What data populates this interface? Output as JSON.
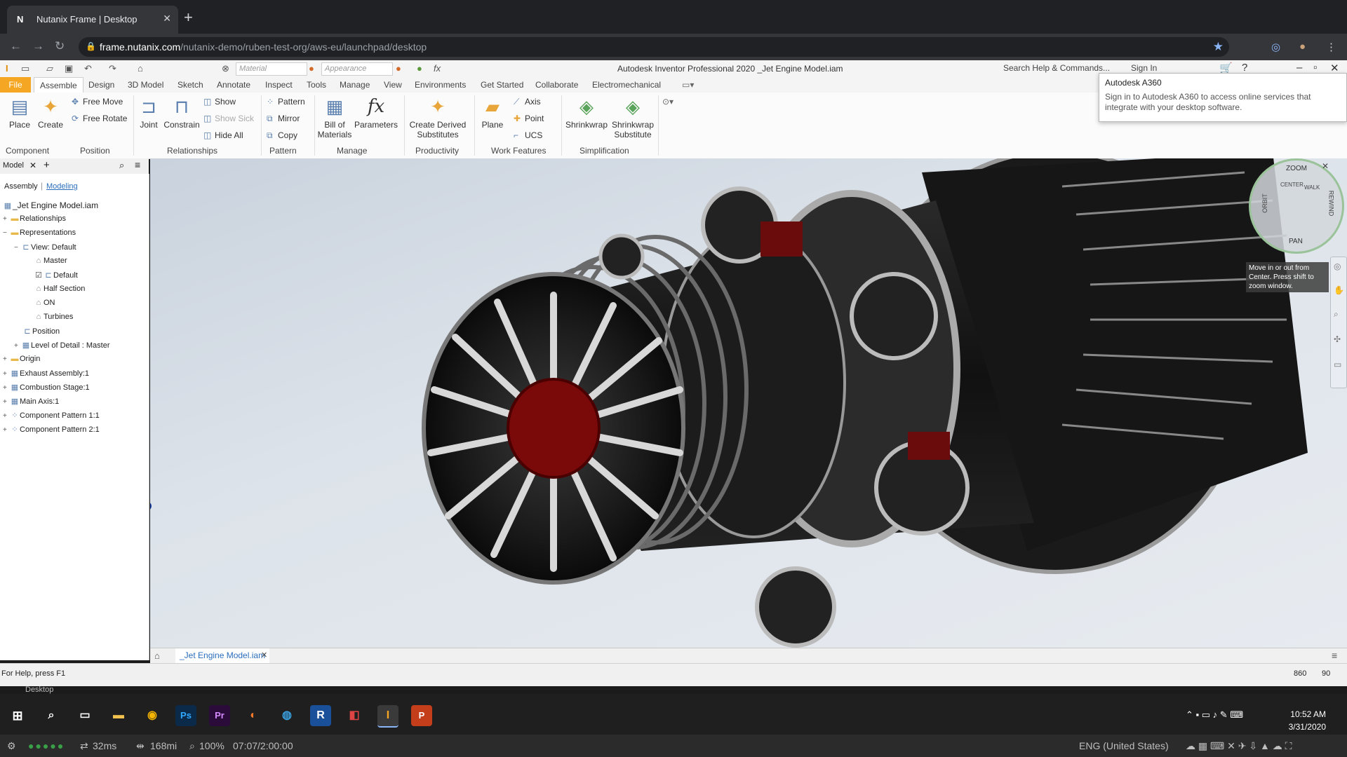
{
  "browser": {
    "tab_title": "Nutanix Frame | Desktop",
    "url_host": "frame.nutanix.com",
    "url_path": "/nutanix-demo/ruben-test-org/aws-eu/launchpad/desktop"
  },
  "inventor": {
    "material_placeholder": "Material",
    "appearance_placeholder": "Appearance",
    "title": "Autodesk Inventor Professional 2020    _Jet Engine Model.iam",
    "search": "Search Help & Commands...",
    "sign_in": "Sign In",
    "tabs": [
      "File",
      "Assemble",
      "Design",
      "3D Model",
      "Sketch",
      "Annotate",
      "Inspect",
      "Tools",
      "Manage",
      "View",
      "Environments",
      "Get Started",
      "Collaborate",
      "Electromechanical"
    ],
    "ribbon": {
      "place": "Place",
      "create": "Create",
      "free_move": "Free Move",
      "free_rotate": "Free Rotate",
      "joint": "Joint",
      "constrain": "Constrain",
      "show": "Show",
      "show_sick": "Show Sick",
      "hide_all": "Hide All",
      "pattern": "Pattern",
      "mirror": "Mirror",
      "copy": "Copy",
      "bom": "Bill of\nMaterials",
      "bom1": "Bill of",
      "bom2": "Materials",
      "parameters": "Parameters",
      "cds1": "Create Derived",
      "cds2": "Substitutes",
      "plane": "Plane",
      "axis": "Axis",
      "point": "Point",
      "ucs": "UCS",
      "shrinkwrap": "Shrinkwrap",
      "sws1": "Shrinkwrap",
      "sws2": "Substitute",
      "groups": [
        "Component",
        "Position",
        "Relationships",
        "Pattern",
        "Manage",
        "Productivity",
        "Work Features",
        "Simplification"
      ]
    },
    "tooltip": {
      "title": "Autodesk A360",
      "body": "Sign in to Autodesk A360 to access online services that integrate with your desktop software."
    },
    "pane": {
      "tab": "Model",
      "subtab_assembly": "Assembly",
      "subtab_modeling": "Modeling",
      "tree": [
        "_Jet Engine Model.iam",
        "Relationships",
        "Representations",
        "View: Default",
        "Master",
        "Default",
        "Half Section",
        "ON",
        "Turbines",
        "Position",
        "Level of Detail : Master",
        "Origin",
        "Exhaust Assembly:1",
        "Combustion Stage:1",
        "Main Axis:1",
        "Component Pattern 1:1",
        "Component Pattern 2:1"
      ]
    },
    "viewcube": {
      "zoom": "ZOOM",
      "orbit": "ORBIT",
      "center": "CENTER",
      "walk": "WALK",
      "rewind": "REWIND",
      "pan": "PAN",
      "hint": "Move in or out from Center. Press shift to zoom window."
    },
    "doc_tab": "_Jet Engine Model.iam",
    "status_help": "For Help, press F1",
    "status_n1": "860",
    "status_n2": "90"
  },
  "desktop_label": "Desktop",
  "clock": {
    "time": "10:52 AM",
    "date": "3/31/2020"
  },
  "frame_bar": {
    "latency": "32ms",
    "distance": "168mi",
    "zoom": "100%",
    "session": "07:07/2:00:00",
    "language": "ENG (United States)"
  },
  "colors": {
    "file_tab": "#f5a623",
    "chrome_dark": "#202124",
    "engine_red": "#8a1010"
  },
  "icons": [
    "lock-icon",
    "star-icon",
    "search-icon",
    "home-icon",
    "windows-icon",
    "settings-icon"
  ]
}
